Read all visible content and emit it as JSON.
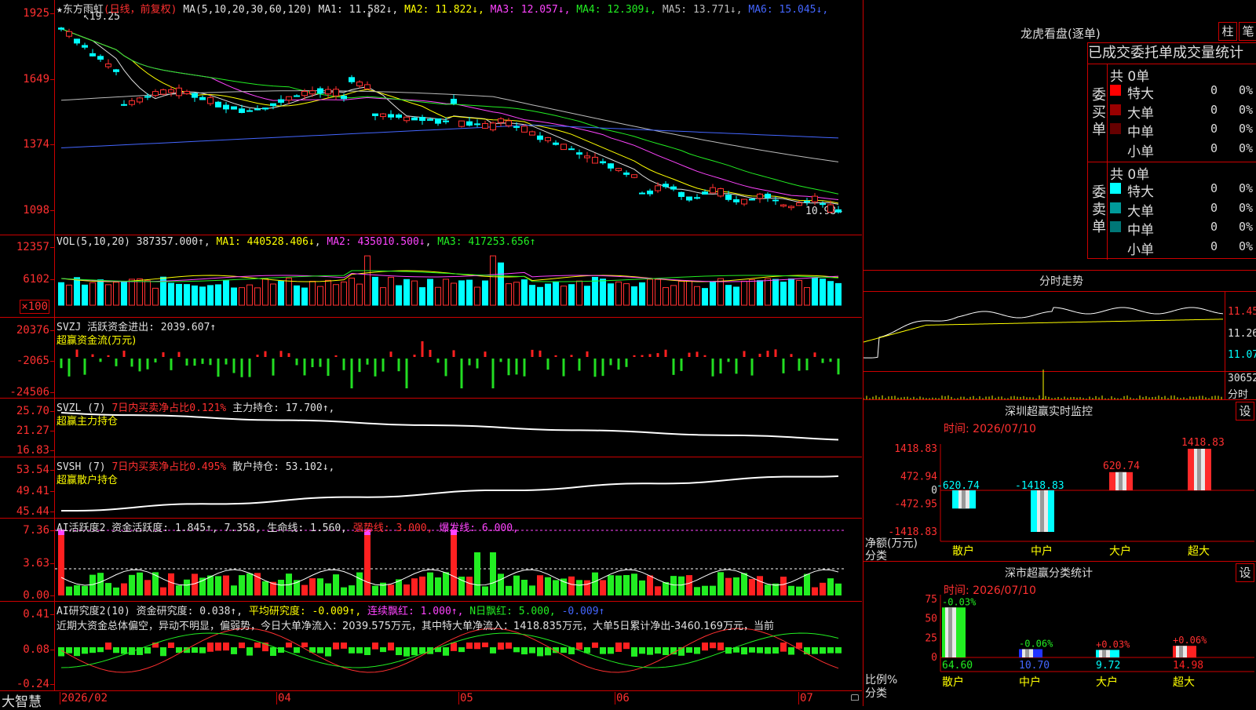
{
  "app": {
    "brand": "大智慧"
  },
  "kline": {
    "title": "★东方雨虹",
    "mode": "(日线，前复权)",
    "ma_label": "MA(5,10,20,30,60,120)",
    "ma": [
      {
        "name": "MA1:",
        "value": "11.582↓",
        "color": "#e0e0e0"
      },
      {
        "name": "MA2:",
        "value": "11.822↓",
        "color": "#ffff00"
      },
      {
        "name": "MA3:",
        "value": "12.057↓",
        "color": "#ff44ff"
      },
      {
        "name": "MA4:",
        "value": "12.309↓",
        "color": "#22ee22"
      },
      {
        "name": "MA5:",
        "value": "13.771↓",
        "color": "#bbbbbb"
      },
      {
        "name": "MA6:",
        "value": "15.045↓",
        "color": "#4466ff"
      }
    ],
    "yticks": [
      "1925",
      "1649",
      "1374",
      "1098"
    ],
    "high_mark": "19.25",
    "low_mark": "10.98",
    "star": "⇟"
  },
  "vol": {
    "label": "VOL(5,10,20)",
    "value": "387357.000↑",
    "ma1": "MA1: 440528.406↓",
    "ma2": "MA2: 435010.500↓",
    "ma3": "MA3: 417253.656↑",
    "yticks": [
      "12357",
      "6102"
    ],
    "unit": "×100"
  },
  "svzj": {
    "label": "SVZJ  活跃资金进出: 2039.607↑",
    "sub": "超赢资金流(万元)",
    "yticks": [
      "20376",
      "-2065",
      "-24506"
    ]
  },
  "svzl": {
    "name": "SVZL (7)",
    "ratio": "7日内买卖净占比0.121%",
    "hold": "主力持仓: 17.700↑,",
    "sub": "超赢主力持仓",
    "yticks": [
      "25.70",
      "21.27",
      "16.83"
    ]
  },
  "svsh": {
    "name": "SVSH (7)",
    "ratio": "7日内买卖净占比0.495%",
    "hold": "散户持仓: 53.102↓,",
    "sub": "超赢散户持仓",
    "yticks": [
      "53.54",
      "49.41",
      "45.44"
    ]
  },
  "ai_active": {
    "label": "AI活跃度2 资金活跃度: 1.845↑, 7.358, 生命线: 1.560,",
    "strong": "强势线: 3.000,",
    "burst": "爆发线: 6.000,",
    "yticks": [
      "7.36",
      "3.63",
      "0.00"
    ]
  },
  "ai_research": {
    "label": "AI研究度2(10) 资金研究度: 0.038↑,",
    "avg": "平均研究度: -0.009↑,",
    "lianxu": "连续飘红: 1.000↑,",
    "nday": "N日飘红: 5.000,",
    "last": "-0.009↑",
    "comment": "近期大资金总体偏空，异动不明显，偏弱势，今日大单净流入：2039.575万元，其中特大单净流入：1418.835万元，大单5日累计净出-3460.169万元，当前",
    "yticks": [
      "0.41",
      "0.08",
      "-0.24"
    ]
  },
  "xaxis": [
    "2026/02",
    "04",
    "05",
    "06",
    "07"
  ],
  "dragon": {
    "title": "龙虎看盘(逐单)",
    "btn1": "柱",
    "btn2": "笔",
    "header": "已成交委托单成交量统计",
    "buy_side": "委买单",
    "sell_side": "委卖单",
    "buy_total": "共 0单",
    "sell_total": "共 0单",
    "buy_rows": [
      {
        "label": "特大",
        "count": "0",
        "pct": "0%",
        "color": "#ff0000"
      },
      {
        "label": "大单",
        "count": "0",
        "pct": "0%",
        "color": "#990000"
      },
      {
        "label": "中单",
        "count": "0",
        "pct": "0%",
        "color": "#660000"
      },
      {
        "label": "小单",
        "count": "0",
        "pct": "0%",
        "color": "#000000"
      }
    ],
    "sell_rows": [
      {
        "label": "特大",
        "count": "0",
        "pct": "0%",
        "color": "#00ffff"
      },
      {
        "label": "大单",
        "count": "0",
        "pct": "0%",
        "color": "#009999"
      },
      {
        "label": "中单",
        "count": "0",
        "pct": "0%",
        "color": "#007777"
      },
      {
        "label": "小单",
        "count": "0",
        "pct": "0%",
        "color": "#000000"
      }
    ]
  },
  "intraday": {
    "title": "分时走势",
    "yticks": [
      "11.45",
      "11.26",
      "11.07"
    ],
    "vol_label": "30652",
    "vol_unit": "分时"
  },
  "monitor": {
    "title": "深圳超赢实时监控",
    "settings": "设",
    "time": "时间: 2026/07/10",
    "yticks": [
      "1418.83",
      "472.94",
      "0",
      "-472.95",
      "-1418.83"
    ],
    "ylab1": "净额(万元)",
    "ylab2": "分类",
    "chart_data": {
      "type": "bar",
      "categories": [
        "散户",
        "中户",
        "大户",
        "超大"
      ],
      "values": [
        -620.74,
        -1418.83,
        620.74,
        1418.83
      ],
      "labels": [
        "-620.74",
        "-1418.83",
        "620.74",
        "1418.83"
      ],
      "ylim": [
        -1418.83,
        1418.83
      ]
    }
  },
  "classify": {
    "title": "深市超赢分类统计",
    "settings": "设",
    "time": "时间: 2026/07/10",
    "yticks": [
      "75",
      "50",
      "25",
      "0"
    ],
    "ylab1": "比例%",
    "ylab2": "分类",
    "chart_data": {
      "type": "bar",
      "categories": [
        "散户",
        "中户",
        "大户",
        "超大"
      ],
      "values": [
        64.6,
        10.7,
        9.72,
        14.98
      ],
      "top_labels": [
        "-0.03%",
        "-0.06%",
        "+0.03%",
        "+0.06%"
      ],
      "value_labels": [
        "64.60",
        "10.70",
        "9.72",
        "14.98"
      ],
      "colors": [
        "#22ee22",
        "#2233ff",
        "#00ffff",
        "#ff2222"
      ],
      "ylim": [
        0,
        75
      ]
    }
  }
}
